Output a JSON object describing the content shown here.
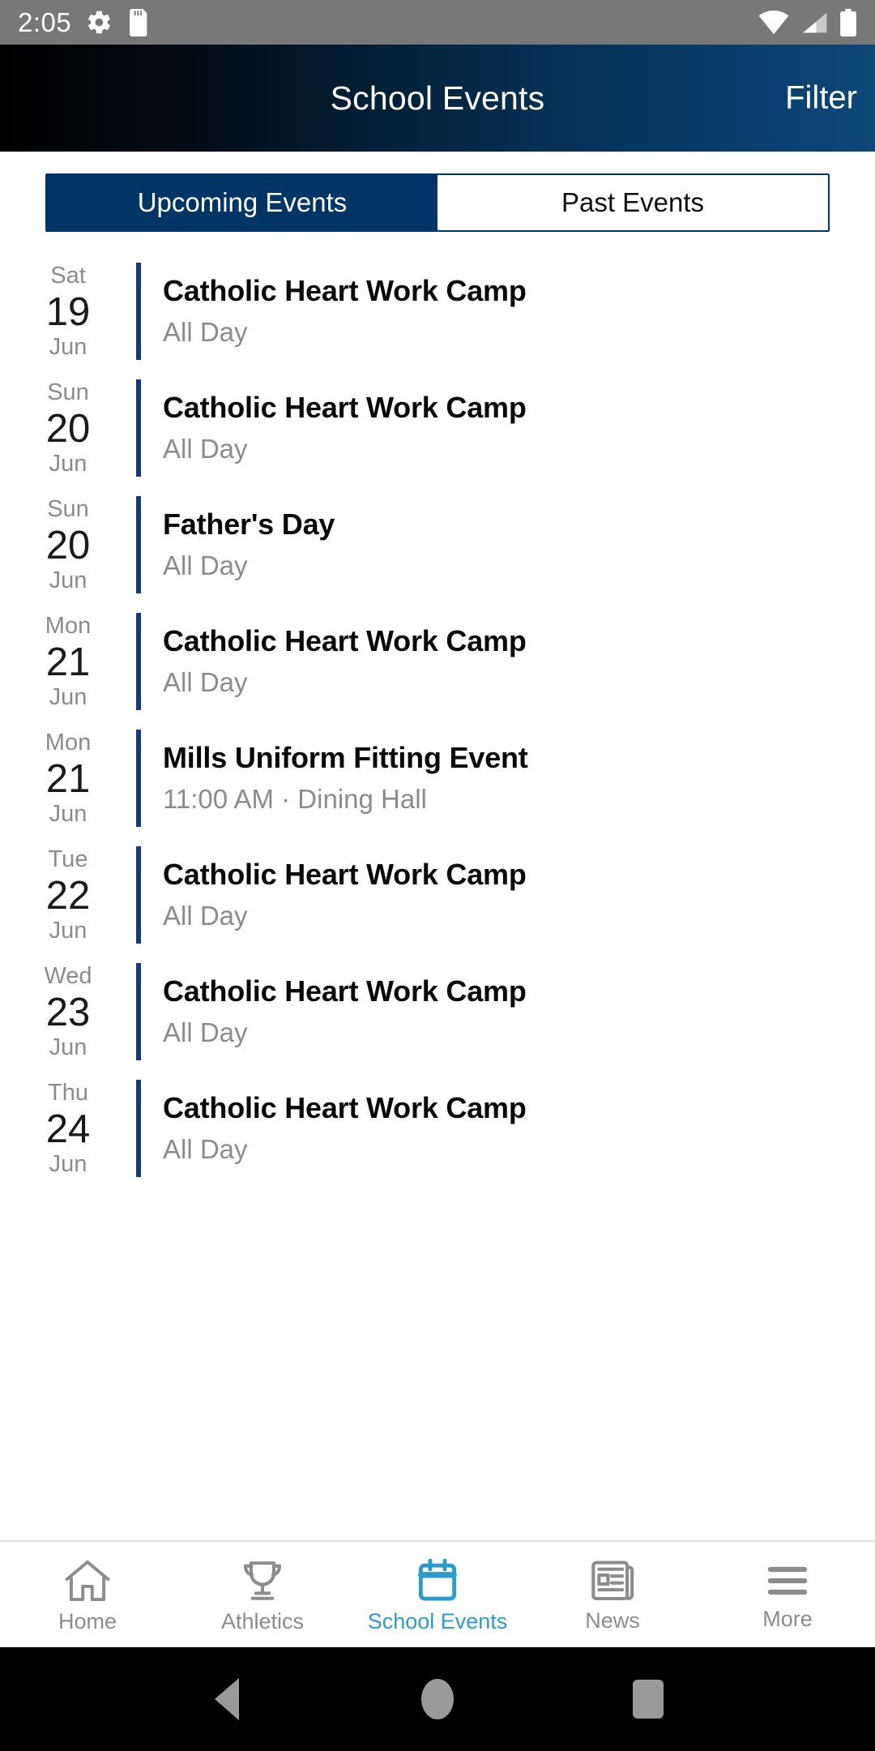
{
  "statusbar": {
    "clock": "2:05",
    "icons_left": [
      "settings-gear-icon",
      "sd-card-icon"
    ],
    "icons_right": [
      "wifi-icon",
      "cellular-signal-icon",
      "battery-icon"
    ]
  },
  "header": {
    "title": "School Events",
    "action_label": "Filter"
  },
  "tabs": [
    {
      "label": "Upcoming Events",
      "active": true
    },
    {
      "label": "Past Events",
      "active": false
    }
  ],
  "events": [
    {
      "dow": "Sat",
      "day": "19",
      "month": "Jun",
      "title": "Catholic Heart Work Camp",
      "sub": "All Day"
    },
    {
      "dow": "Sun",
      "day": "20",
      "month": "Jun",
      "title": "Catholic Heart Work Camp",
      "sub": "All Day"
    },
    {
      "dow": "Sun",
      "day": "20",
      "month": "Jun",
      "title": "Father's Day",
      "sub": "All Day"
    },
    {
      "dow": "Mon",
      "day": "21",
      "month": "Jun",
      "title": "Catholic Heart Work Camp",
      "sub": "All Day"
    },
    {
      "dow": "Mon",
      "day": "21",
      "month": "Jun",
      "title": "Mills Uniform Fitting Event",
      "sub": "11:00 AM · Dining Hall"
    },
    {
      "dow": "Tue",
      "day": "22",
      "month": "Jun",
      "title": "Catholic Heart Work Camp",
      "sub": "All Day"
    },
    {
      "dow": "Wed",
      "day": "23",
      "month": "Jun",
      "title": "Catholic Heart Work Camp",
      "sub": "All Day"
    },
    {
      "dow": "Thu",
      "day": "24",
      "month": "Jun",
      "title": "Catholic Heart Work Camp",
      "sub": "All Day"
    }
  ],
  "bottom_nav": [
    {
      "label": "Home",
      "icon": "home-icon",
      "active": false
    },
    {
      "label": "Athletics",
      "icon": "trophy-icon",
      "active": false
    },
    {
      "label": "School Events",
      "icon": "calendar-icon",
      "active": true
    },
    {
      "label": "News",
      "icon": "newspaper-icon",
      "active": false
    },
    {
      "label": "More",
      "icon": "hamburger-menu-icon",
      "active": false
    }
  ],
  "android_nav": {
    "back": "back-triangle-icon",
    "home": "home-circle-icon",
    "recents": "recents-square-icon"
  },
  "colors": {
    "header_navy": "#013565",
    "accent_bar": "#16397c",
    "active_tab_cyan": "#2c9dcb",
    "muted_text": "#8c8c8c",
    "statusbar_gray": "#787878"
  }
}
